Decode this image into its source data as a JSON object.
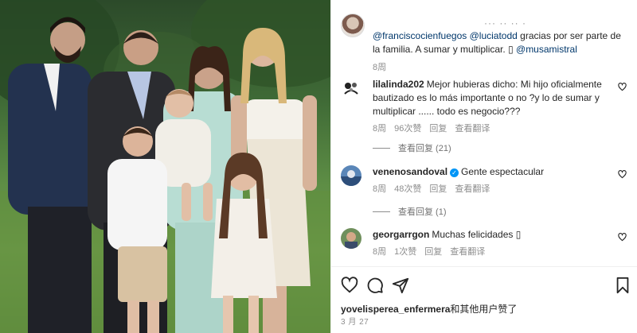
{
  "post": {
    "photo_alt": "family-photo",
    "top_partial_text": "··· ·· ·· ·",
    "caption": {
      "mention_1": "@franciscocienfuegos",
      "mention_2": "@luciatodd",
      "text_1": " gracias por ser parte de la familia. A sumar y multiplicar. ",
      "emoji": "▯",
      "mention_3": " @musamistral"
    },
    "caption_time": "8周"
  },
  "comments": [
    {
      "username": "lilalinda202",
      "text": "Mejor hubieras dicho: Mi hijo oficialmente bautizado es lo más importante o no ?y lo de sumar y multiplicar ...... todo es negocio???",
      "time": "8周",
      "likes": "96次赞",
      "reply": "回复",
      "translate": "查看翻译",
      "view_replies": "查看回复 (21)",
      "avatar_icon": "avatar-lilalinda202"
    },
    {
      "username": "venenosandoval",
      "verified": "✓",
      "text": "Gente espectacular",
      "time": "8周",
      "likes": "48次赞",
      "reply": "回复",
      "translate": "查看翻译",
      "view_replies": "查看回复 (1)",
      "avatar_icon": "avatar-venenosandoval"
    },
    {
      "username": "georgarrgon",
      "text": "Muchas felicidades ▯",
      "time": "8周",
      "likes": "1次赞",
      "reply": "回复",
      "translate": "查看翻译",
      "avatar_icon": "avatar-georgarrgon"
    }
  ],
  "actions": {
    "like_icon": "heart-icon",
    "comment_icon": "comment-icon",
    "share_icon": "share-icon",
    "save_icon": "bookmark-icon"
  },
  "footer": {
    "liked_by_user": "yovelisperea_enfermera",
    "liked_by_suffix": "和其他用户赞了",
    "date": "3 月 27"
  },
  "colors": {
    "link": "#00376b",
    "muted": "#8e8e8e",
    "verified": "#0095f6",
    "text": "#262626"
  }
}
